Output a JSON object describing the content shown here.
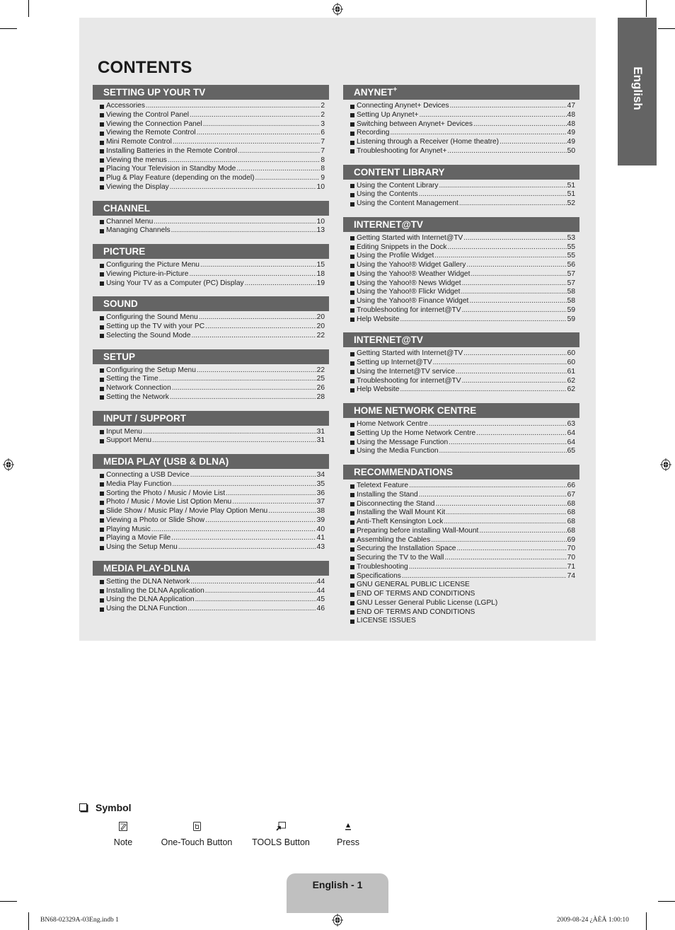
{
  "page": {
    "title": "CONTENTS",
    "language_tab": "English",
    "page_label": "English - 1",
    "footer_file": "BN68-02329A-03Eng.indb   1",
    "footer_timestamp": "2009-08-24   ¿ÀÈÄ 1:00:10"
  },
  "left_sections": [
    {
      "title": "SETTING UP YOUR TV",
      "items": [
        {
          "label": "Accessories",
          "page": "2"
        },
        {
          "label": "Viewing the Control Panel",
          "page": "2"
        },
        {
          "label": "Viewing the Connection Panel",
          "page": "3"
        },
        {
          "label": "Viewing the Remote Control",
          "page": "6"
        },
        {
          "label": "Mini Remote Control",
          "page": "7"
        },
        {
          "label": "Installing Batteries in the Remote Control",
          "page": "7"
        },
        {
          "label": "Viewing the menus",
          "page": "8"
        },
        {
          "label": "Placing Your Television in Standby Mode",
          "page": "8"
        },
        {
          "label": "Plug & Play Feature (depending on the model)",
          "page": "9"
        },
        {
          "label": "Viewing the Display",
          "page": "10"
        }
      ]
    },
    {
      "title": "CHANNEL",
      "items": [
        {
          "label": "Channel Menu",
          "page": "10"
        },
        {
          "label": "Managing Channels",
          "page": "13"
        }
      ]
    },
    {
      "title": "PICTURE",
      "items": [
        {
          "label": "Configuring the Picture Menu",
          "page": "15"
        },
        {
          "label": "Viewing Picture-in-Picture",
          "page": "18"
        },
        {
          "label": "Using Your TV as a Computer (PC) Display",
          "page": "19"
        }
      ]
    },
    {
      "title": "SOUND",
      "items": [
        {
          "label": "Configuring the Sound Menu",
          "page": "20"
        },
        {
          "label": "Setting up the TV with your PC",
          "page": "20"
        },
        {
          "label": "Selecting the Sound Mode",
          "page": "22"
        }
      ]
    },
    {
      "title": "SETUP",
      "items": [
        {
          "label": "Configuring the Setup Menu",
          "page": "22"
        },
        {
          "label": "Setting the Time",
          "page": "25"
        },
        {
          "label": "Network Connection",
          "page": "26"
        },
        {
          "label": "Setting the Network",
          "page": "28"
        }
      ]
    },
    {
      "title": "INPUT / SUPPORT",
      "items": [
        {
          "label": "Input Menu",
          "page": "31"
        },
        {
          "label": "Support Menu",
          "page": "31"
        }
      ]
    },
    {
      "title": "MEDIA PLAY (USB & DLNA)",
      "items": [
        {
          "label": "Connecting a USB Device",
          "page": "34"
        },
        {
          "label": "Media Play Function",
          "page": "35"
        },
        {
          "label": "Sorting the Photo / Music / Movie List",
          "page": "36"
        },
        {
          "label": "Photo / Music / Movie List Option Menu",
          "page": "37"
        },
        {
          "label": "Slide Show / Music Play / Movie Play Option Menu ",
          "page": "38"
        },
        {
          "label": "Viewing a Photo or Slide Show",
          "page": "39"
        },
        {
          "label": "Playing Music",
          "page": "40"
        },
        {
          "label": "Playing a Movie File",
          "page": "41"
        },
        {
          "label": "Using the Setup Menu",
          "page": "43"
        }
      ]
    },
    {
      "title": "MEDIA PLAY-DLNA",
      "items": [
        {
          "label": "Setting the DLNA Network",
          "page": "44"
        },
        {
          "label": "Installing the DLNA Application",
          "page": "44"
        },
        {
          "label": "Using the DLNA Application",
          "page": "45"
        },
        {
          "label": "Using the DLNA Function",
          "page": "46"
        }
      ]
    }
  ],
  "right_sections": [
    {
      "title": "ANYNET",
      "title_sup": "+",
      "items": [
        {
          "label": "Connecting Anynet+ Devices",
          "page": "47"
        },
        {
          "label": "Setting Up Anynet+",
          "page": "48"
        },
        {
          "label": "Switching between Anynet+ Devices",
          "page": "48"
        },
        {
          "label": "Recording",
          "page": "49"
        },
        {
          "label": "Listening through a Receiver (Home theatre)",
          "page": "49"
        },
        {
          "label": "Troubleshooting for Anynet+",
          "page": "50"
        }
      ]
    },
    {
      "title": "CONTENT LIBRARY",
      "items": [
        {
          "label": "Using the Content Library",
          "page": "51"
        },
        {
          "label": "Using the Contents",
          "page": "51"
        },
        {
          "label": "Using the Content Management",
          "page": "52"
        }
      ]
    },
    {
      "title": "INTERNET@TV",
      "items": [
        {
          "label": "Getting Started with Internet@TV",
          "page": "53"
        },
        {
          "label": "Editing Snippets in the Dock",
          "page": "55"
        },
        {
          "label": "Using the Profile Widget",
          "page": "55"
        },
        {
          "label": "Using the Yahoo!® Widget Gallery",
          "page": "56"
        },
        {
          "label": "Using the Yahoo!® Weather Widget",
          "page": "57"
        },
        {
          "label": "Using the Yahoo!® News Widget",
          "page": "57"
        },
        {
          "label": "Using the Yahoo!® Flickr Widget",
          "page": "58"
        },
        {
          "label": "Using the Yahoo!® Finance Widget",
          "page": "58"
        },
        {
          "label": "Troubleshooting for internet@TV",
          "page": "59"
        },
        {
          "label": "Help Website",
          "page": "59"
        }
      ]
    },
    {
      "title": "INTERNET@TV",
      "items": [
        {
          "label": "Getting Started with Internet@TV",
          "page": "60"
        },
        {
          "label": "Setting up Internet@TV",
          "page": "60"
        },
        {
          "label": "Using the Internet@TV service",
          "page": "61"
        },
        {
          "label": "Troubleshooting for internet@TV",
          "page": "62"
        },
        {
          "label": "Help Website",
          "page": "62"
        }
      ]
    },
    {
      "title": "HOME NETWORK CENTRE",
      "items": [
        {
          "label": "Home Network Centre",
          "page": "63"
        },
        {
          "label": "Setting Up the Home Network Centre",
          "page": "64"
        },
        {
          "label": "Using the Message Function",
          "page": "64"
        },
        {
          "label": "Using the Media Function",
          "page": "65"
        }
      ]
    },
    {
      "title": "RECOMMENDATIONS",
      "items": [
        {
          "label": "Teletext Feature",
          "page": "66"
        },
        {
          "label": "Installing the Stand",
          "page": "67"
        },
        {
          "label": "Disconnecting the Stand",
          "page": "68"
        },
        {
          "label": "Installing the Wall Mount Kit",
          "page": "68"
        },
        {
          "label": "Anti-Theft Kensington Lock",
          "page": "68"
        },
        {
          "label": "Preparing before installing Wall-Mount",
          "page": "68"
        },
        {
          "label": "Assembling the Cables",
          "page": "69"
        },
        {
          "label": "Securing the Installation Space",
          "page": "70"
        },
        {
          "label": "Securing the TV to the Wall",
          "page": "70"
        },
        {
          "label": "Troubleshooting",
          "page": "71"
        },
        {
          "label": "Specifications",
          "page": "74"
        },
        {
          "label": "GNU GENERAL PUBLIC LICENSE",
          "page": ""
        },
        {
          "label": "END OF TERMS AND CONDITIONS",
          "page": ""
        },
        {
          "label": "GNU Lesser General Public License (LGPL)",
          "page": ""
        },
        {
          "label": "END OF TERMS AND CONDITIONS",
          "page": ""
        },
        {
          "label": "LICENSE ISSUES",
          "page": ""
        }
      ]
    }
  ],
  "symbols": {
    "heading": "Symbol",
    "items": [
      {
        "icon": "note-icon",
        "label": "Note"
      },
      {
        "icon": "one-touch-button-icon",
        "label": "One-Touch Button"
      },
      {
        "icon": "tools-button-icon",
        "label": "TOOLS Button"
      },
      {
        "icon": "press-icon",
        "label": "Press"
      }
    ]
  }
}
